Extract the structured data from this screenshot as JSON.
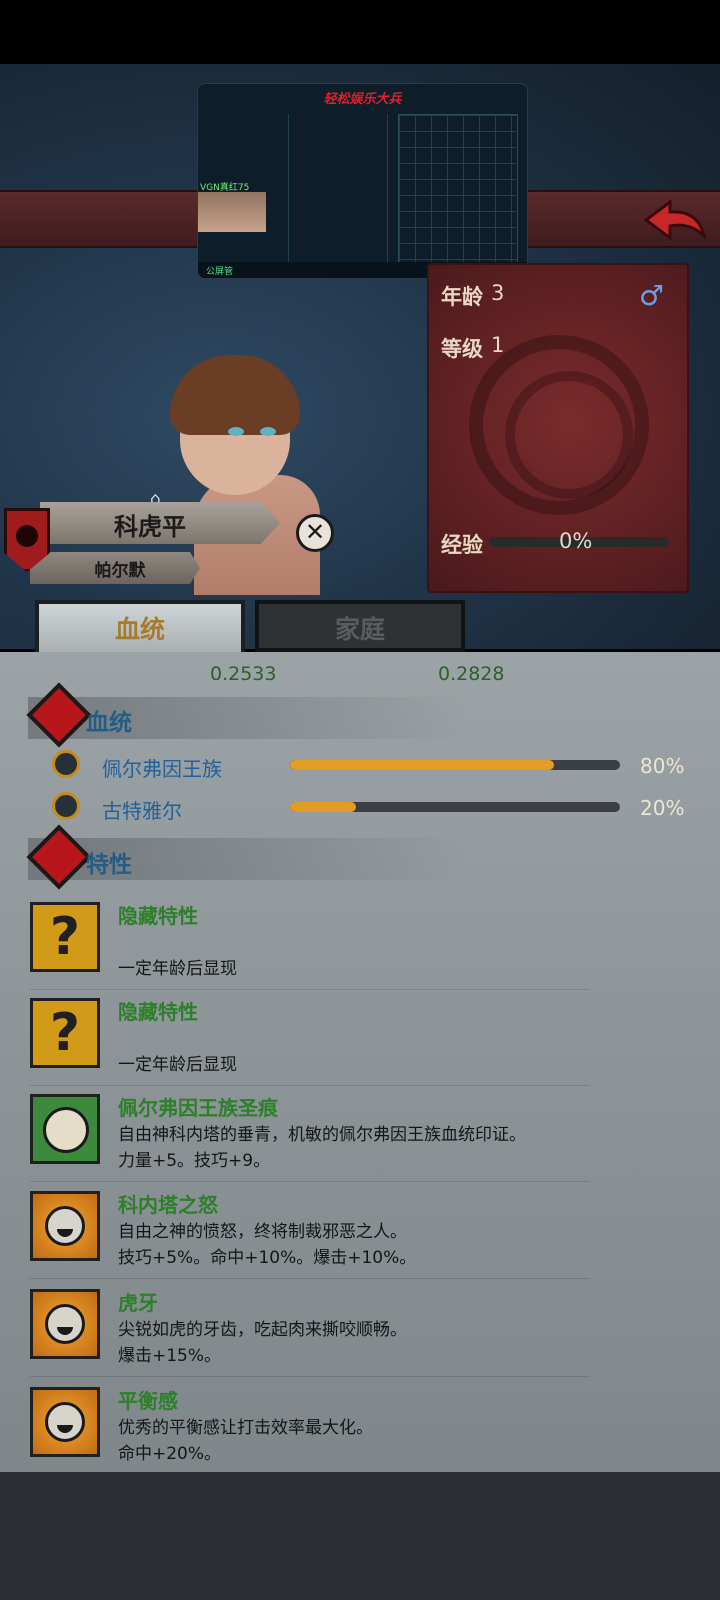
{
  "stream_overlay": {
    "title": "轻松娱乐大兵",
    "user": "VGN真红75",
    "bottom_text": "公屏管"
  },
  "card": {
    "age_label": "年龄",
    "age_value": "3",
    "level_label": "等级",
    "level_value": "1",
    "exp_label": "经验",
    "exp_value": "0%",
    "gender_icon": "male-symbol"
  },
  "character": {
    "name": "科虎平",
    "sub_name": "帕尔默"
  },
  "tabs": [
    {
      "label": "血统",
      "active": true
    },
    {
      "label": "家庭",
      "active": false
    }
  ],
  "values": [
    "0.2533",
    "0.2828"
  ],
  "lineage": {
    "title": "血统",
    "items": [
      {
        "name": "佩尔弗因王族",
        "percent": "80%",
        "fraction": 0.8
      },
      {
        "name": "古特雅尔",
        "percent": "20%",
        "fraction": 0.2
      }
    ]
  },
  "traits": {
    "title": "特性",
    "items": [
      {
        "name": "隐藏特性",
        "desc1": "",
        "desc2": "一定年龄后显现",
        "icon": "question-icon"
      },
      {
        "name": "隐藏特性",
        "desc1": "",
        "desc2": "一定年龄后显现",
        "icon": "question-icon"
      },
      {
        "name": "佩尔弗因王族圣痕",
        "desc1": "自由神科内塔的垂青，机敏的佩尔弗因王族血统印证。",
        "desc2": "力量+5。技巧+9。",
        "icon": "leaf-icon"
      },
      {
        "name": "科内塔之怒",
        "desc1": "自由之神的愤怒，终将制裁邪恶之人。",
        "desc2": "技巧+5%。命中+10%。爆击+10%。",
        "icon": "smile-icon"
      },
      {
        "name": "虎牙",
        "desc1": "尖锐如虎的牙齿，吃起肉来撕咬顺畅。",
        "desc2": "爆击+15%。",
        "icon": "smile-icon"
      },
      {
        "name": "平衡感",
        "desc1": "优秀的平衡感让打击效率最大化。",
        "desc2": "命中+20%。",
        "icon": "smile-icon"
      }
    ]
  },
  "colors": {
    "accent_gold": "#e19d24",
    "trait_name_green": "#2d7f2a",
    "lineage_blue": "#23619a",
    "banner_red": "#5a2a2c"
  }
}
